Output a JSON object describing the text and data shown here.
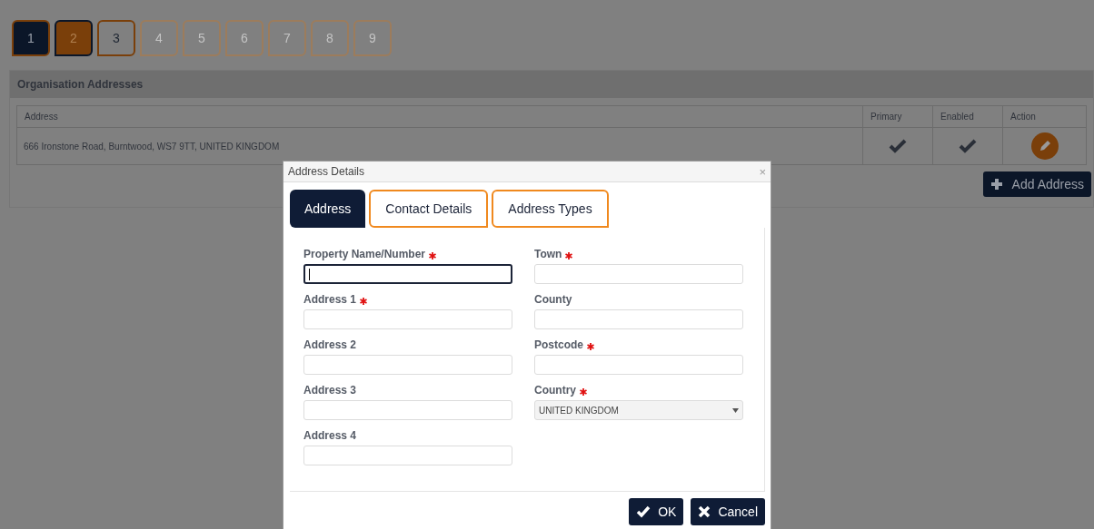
{
  "steps": [
    {
      "label": "1",
      "kind": "current"
    },
    {
      "label": "2",
      "kind": "done"
    },
    {
      "label": "3",
      "kind": "next"
    },
    {
      "label": "4",
      "kind": "locked"
    },
    {
      "label": "5",
      "kind": "locked"
    },
    {
      "label": "6",
      "kind": "locked"
    },
    {
      "label": "7",
      "kind": "locked"
    },
    {
      "label": "8",
      "kind": "locked"
    },
    {
      "label": "9",
      "kind": "locked"
    }
  ],
  "panel": {
    "title": "Organisation Addresses",
    "table": {
      "columns": [
        "Address",
        "Primary",
        "Enabled",
        "Action"
      ],
      "rows": [
        {
          "address": "666 Ironstone Road, Burntwood, WS7 9TT, UNITED KINGDOM",
          "primary": true,
          "enabled": true
        }
      ]
    },
    "add_button": "Add Address"
  },
  "dialog": {
    "title": "Address Details",
    "close": "×",
    "tabs": [
      {
        "label": "Address",
        "selected": true
      },
      {
        "label": "Contact Details",
        "selected": false
      },
      {
        "label": "Address Types",
        "selected": false
      }
    ],
    "columns": [
      [
        {
          "label": "Property Name/Number",
          "required": true,
          "kind": "text",
          "focused": true
        },
        {
          "label": "Address 1",
          "required": true,
          "kind": "text",
          "focused": false
        },
        {
          "label": "Address 2",
          "required": false,
          "kind": "text",
          "focused": false
        },
        {
          "label": "Address 3",
          "required": false,
          "kind": "text",
          "focused": false
        },
        {
          "label": "Address 4",
          "required": false,
          "kind": "text",
          "focused": false
        }
      ],
      [
        {
          "label": "Town",
          "required": true,
          "kind": "text",
          "focused": false
        },
        {
          "label": "County",
          "required": false,
          "kind": "text",
          "focused": false
        },
        {
          "label": "Postcode",
          "required": true,
          "kind": "text",
          "focused": false
        },
        {
          "label": "Country",
          "required": true,
          "kind": "select",
          "value": "UNITED KINGDOM",
          "focused": false
        }
      ]
    ],
    "ok": "OK",
    "cancel": "Cancel"
  }
}
